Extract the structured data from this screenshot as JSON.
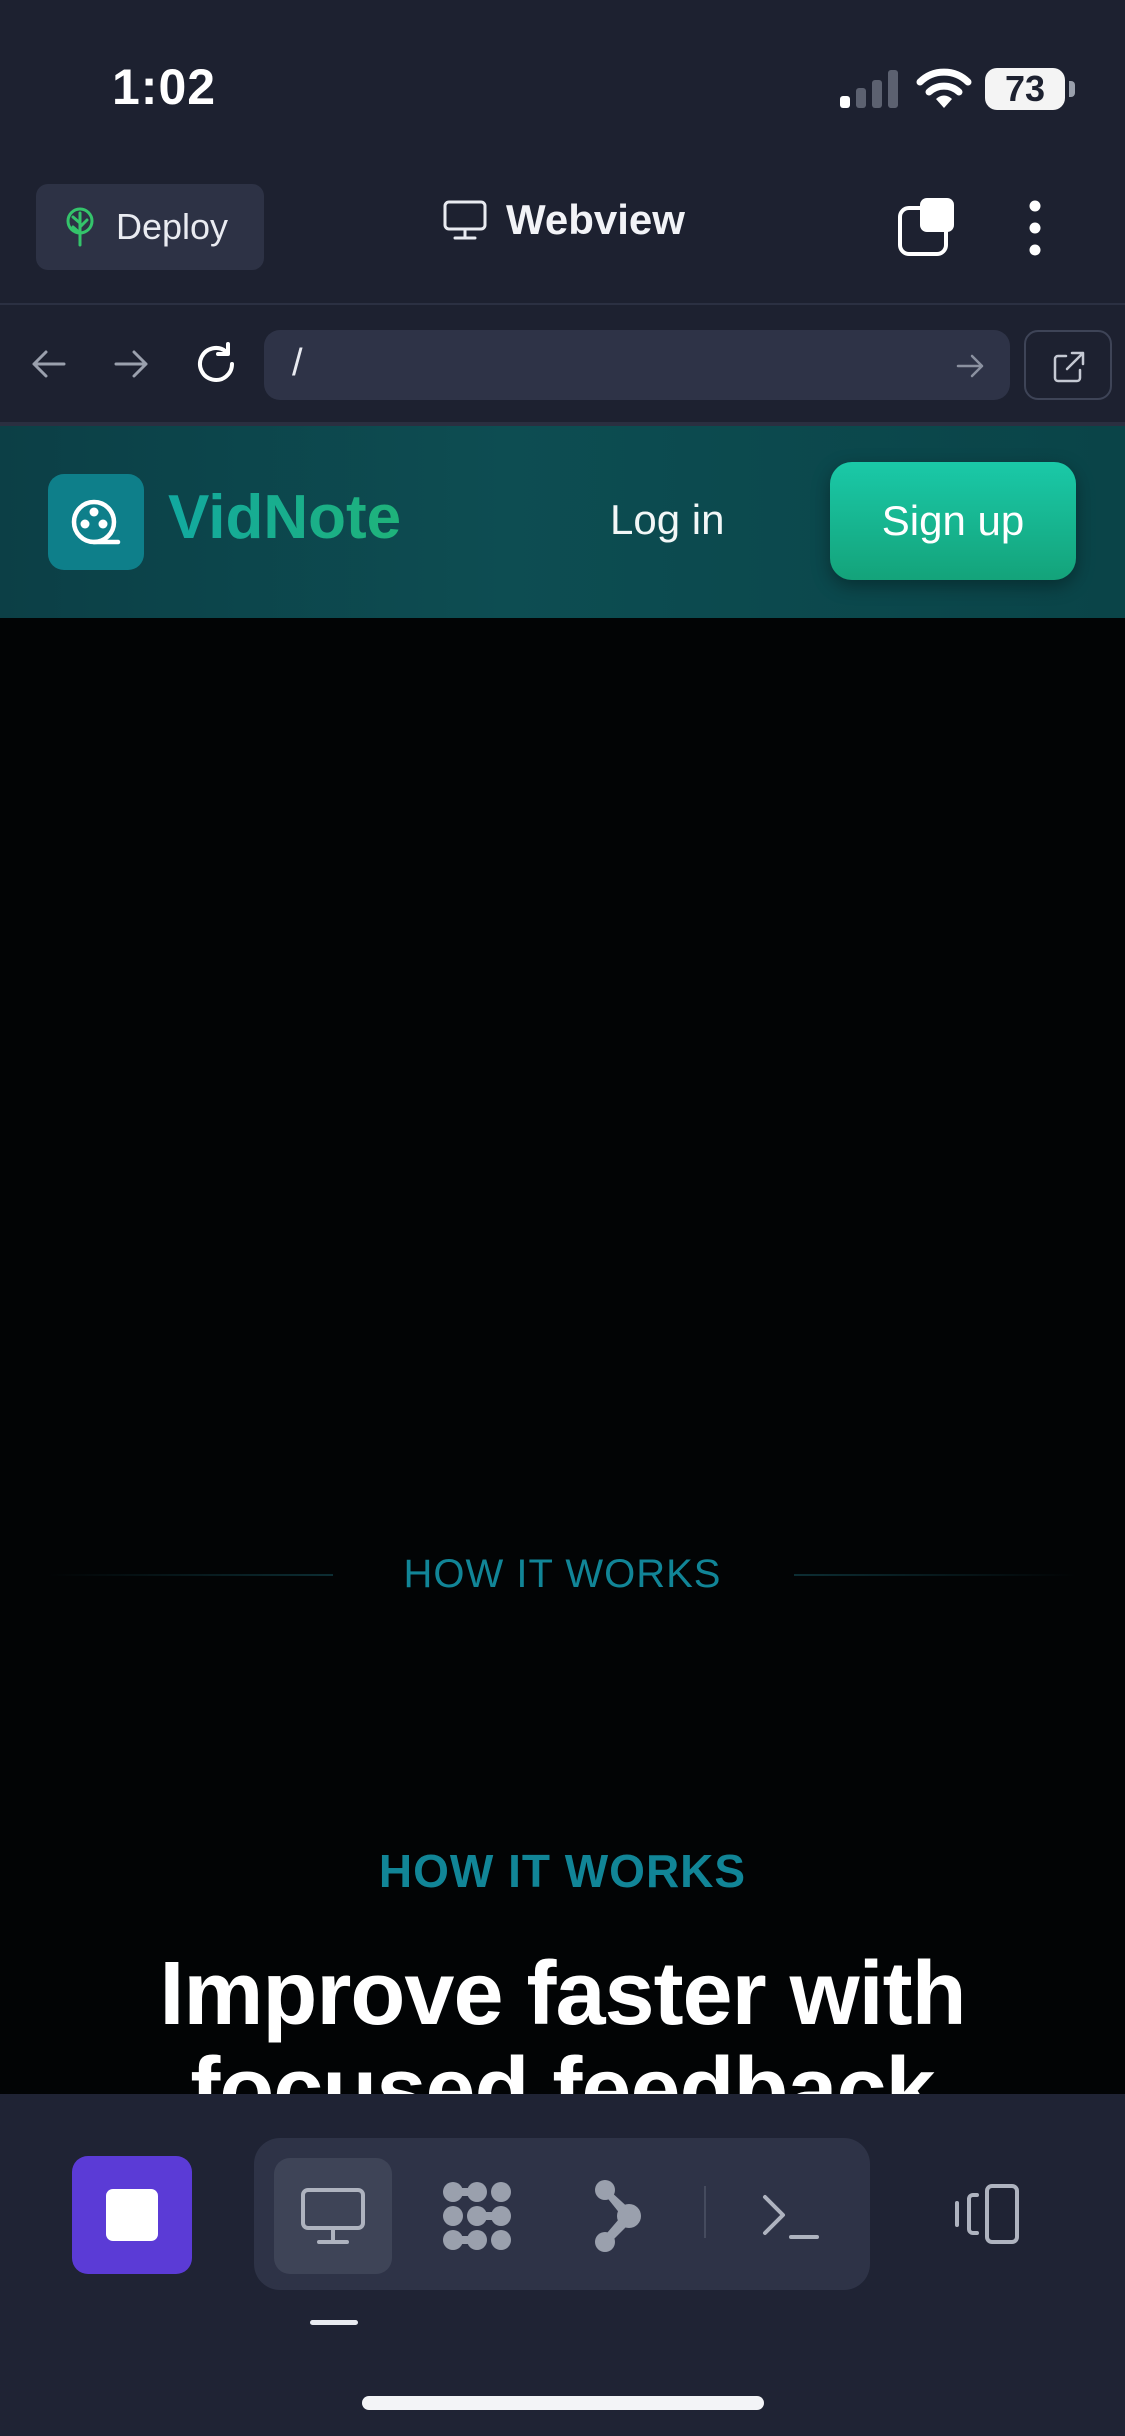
{
  "status_bar": {
    "time": "1:02",
    "battery": "73",
    "signal_icon": "cellular-signal-icon",
    "wifi_icon": "wifi-icon"
  },
  "top_bar": {
    "deploy_label": "Deploy",
    "deploy_icon": "deploy-tree-icon",
    "title": "Webview",
    "title_icon": "monitor-icon",
    "tabs_icon": "tabs-icon",
    "menu_icon": "more-vertical-icon"
  },
  "url_bar": {
    "back_icon": "arrow-left-icon",
    "forward_icon": "arrow-right-icon",
    "reload_icon": "reload-icon",
    "url": "/",
    "go_icon": "arrow-right-icon",
    "open_external_icon": "external-link-icon"
  },
  "site": {
    "brand": "VidNote",
    "logo_icon": "film-reel-icon",
    "login": "Log in",
    "signup": "Sign up",
    "eyebrow_small": "HOW IT WORKS",
    "eyebrow": "HOW IT WORKS",
    "heading_line1": "Improve faster with",
    "heading_line2": "focused feedback"
  },
  "bottom_bar": {
    "stop_icon": "stop-icon",
    "tools": [
      "webview-icon",
      "workflow-icon",
      "git-icon",
      "terminal-icon"
    ],
    "devices_icon": "devices-icon"
  },
  "colors": {
    "app_bg": "#1d2130",
    "accent_purple": "#5b3bd6",
    "brand_teal": "#118597",
    "signup_green": "#14a37a"
  }
}
